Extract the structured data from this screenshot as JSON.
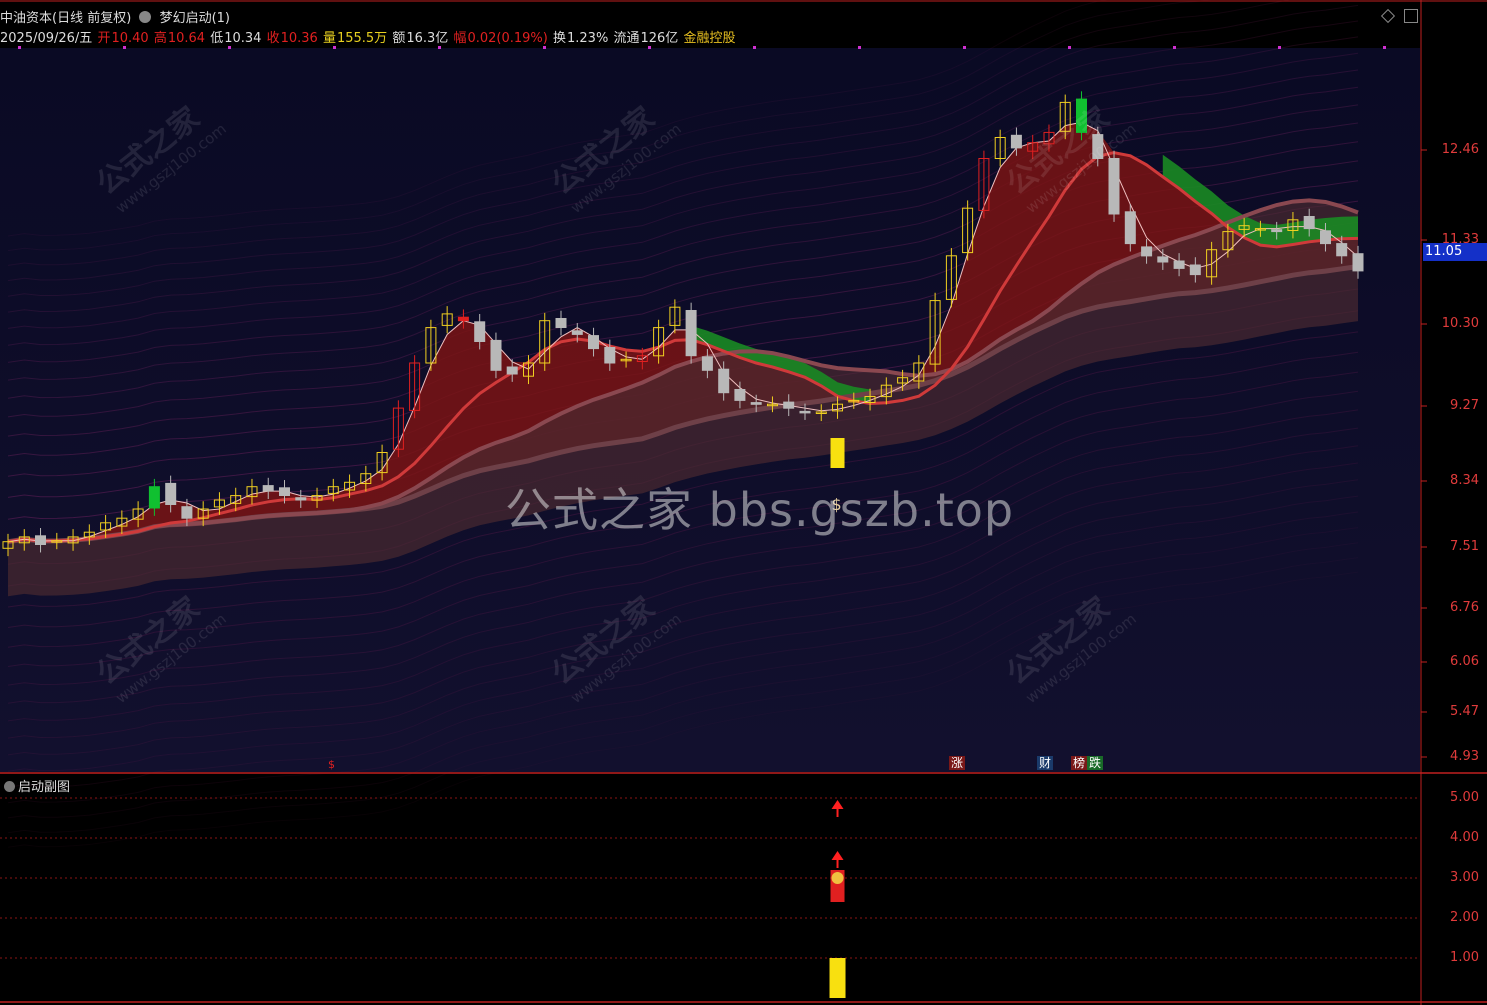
{
  "title_bar": {
    "stock_name": "中油资本(日线 前复权)",
    "indicator_name": "梦幻启动(1)"
  },
  "quote": {
    "date": "2025/09/26/五",
    "open_label": "开",
    "open": "10.40",
    "high_label": "高",
    "high": "10.64",
    "low_label": "低",
    "low": "10.34",
    "close_label": "收",
    "close": "10.36",
    "volume_label": "量",
    "volume": "155.5万",
    "amount_label": "额",
    "amount": "16.3亿",
    "change_label": "幅",
    "change": "0.02(0.19%)",
    "turnover_label": "换",
    "turnover": "1.23%",
    "float_label": "流通",
    "float_cap": "126亿",
    "sector": "金融控股"
  },
  "main_axis": {
    "labels": [
      "12.46",
      "11.33",
      "10.30",
      "9.27",
      "8.34",
      "7.51",
      "6.76",
      "6.06",
      "5.47",
      "4.93"
    ],
    "current_price": "11.05"
  },
  "sub_axis": {
    "labels": [
      "5.00",
      "4.00",
      "3.00",
      "2.00",
      "1.00"
    ]
  },
  "sub_panel": {
    "title": "启动副图"
  },
  "markers": {
    "s_mark": "$",
    "zhang": "涨",
    "cai": "财",
    "bang": "榜",
    "die": "跌"
  },
  "watermarks": {
    "cn": "公式之家",
    "url": "www.gszj100.com",
    "center": "公式之家 bbs.gszb.top"
  },
  "colors": {
    "up": "#e02020",
    "down": "#b8b8b8",
    "limit_up": "#f0d020",
    "green_bar": "#10c030",
    "axis": "#e03b3b",
    "price_tag": "#1430c8"
  },
  "chart_data": {
    "type": "candlestick",
    "price_axis_ticks": [
      12.46,
      11.33,
      10.3,
      9.27,
      8.34,
      7.51,
      6.76,
      6.06,
      5.47,
      4.93
    ],
    "last_close": 10.36,
    "last_open": 10.4,
    "last_high": 10.64,
    "last_low": 10.34,
    "current_price_tag": 11.05,
    "sub_indicator_ticks": [
      5.0,
      4.0,
      3.0,
      2.0,
      1.0
    ]
  }
}
